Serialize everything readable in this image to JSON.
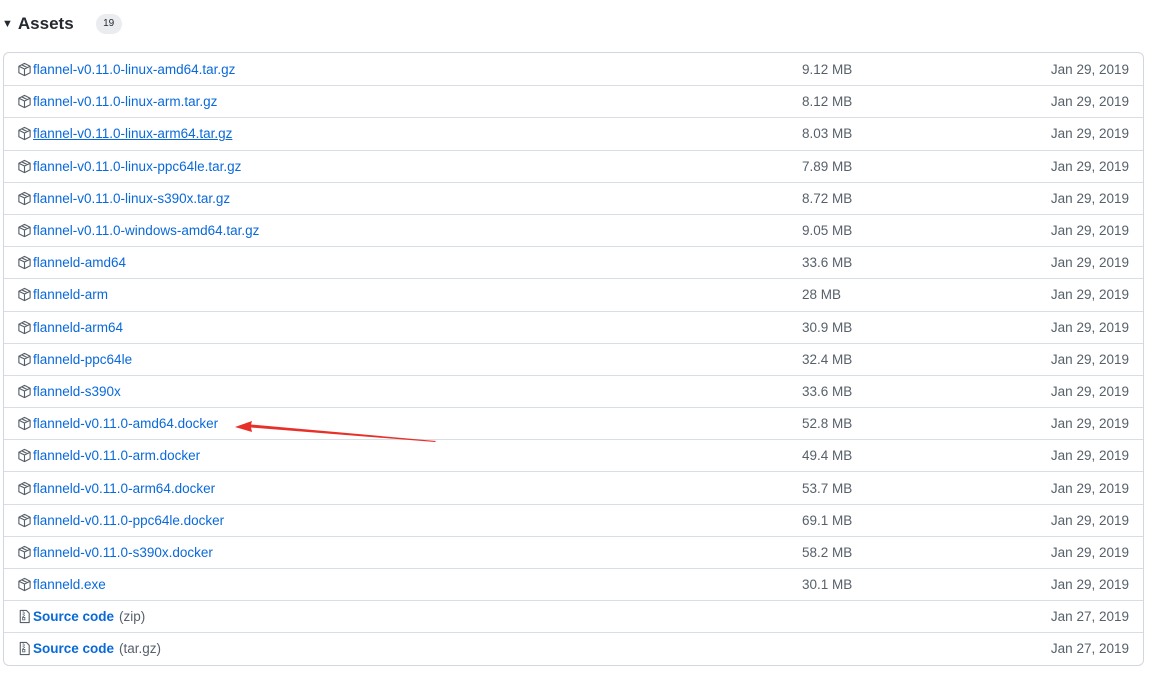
{
  "assets": {
    "title": "Assets",
    "count": "19",
    "caret_icon": "triangle-down-icon",
    "rows": [
      {
        "name": "flannel-v0.11.0-linux-amd64.tar.gz",
        "size": "9.12 MB",
        "date": "Jan 29, 2019",
        "icon": "package-icon"
      },
      {
        "name": "flannel-v0.11.0-linux-arm.tar.gz",
        "size": "8.12 MB",
        "date": "Jan 29, 2019",
        "icon": "package-icon"
      },
      {
        "name": "flannel-v0.11.0-linux-arm64.tar.gz",
        "size": "8.03 MB",
        "date": "Jan 29, 2019",
        "icon": "package-icon",
        "hovered": true
      },
      {
        "name": "flannel-v0.11.0-linux-ppc64le.tar.gz",
        "size": "7.89 MB",
        "date": "Jan 29, 2019",
        "icon": "package-icon"
      },
      {
        "name": "flannel-v0.11.0-linux-s390x.tar.gz",
        "size": "8.72 MB",
        "date": "Jan 29, 2019",
        "icon": "package-icon"
      },
      {
        "name": "flannel-v0.11.0-windows-amd64.tar.gz",
        "size": "9.05 MB",
        "date": "Jan 29, 2019",
        "icon": "package-icon"
      },
      {
        "name": "flanneld-amd64",
        "size": "33.6 MB",
        "date": "Jan 29, 2019",
        "icon": "package-icon"
      },
      {
        "name": "flanneld-arm",
        "size": "28 MB",
        "date": "Jan 29, 2019",
        "icon": "package-icon"
      },
      {
        "name": "flanneld-arm64",
        "size": "30.9 MB",
        "date": "Jan 29, 2019",
        "icon": "package-icon"
      },
      {
        "name": "flanneld-ppc64le",
        "size": "32.4 MB",
        "date": "Jan 29, 2019",
        "icon": "package-icon"
      },
      {
        "name": "flanneld-s390x",
        "size": "33.6 MB",
        "date": "Jan 29, 2019",
        "icon": "package-icon"
      },
      {
        "name": "flanneld-v0.11.0-amd64.docker",
        "size": "52.8 MB",
        "date": "Jan 29, 2019",
        "icon": "package-icon"
      },
      {
        "name": "flanneld-v0.11.0-arm.docker",
        "size": "49.4 MB",
        "date": "Jan 29, 2019",
        "icon": "package-icon"
      },
      {
        "name": "flanneld-v0.11.0-arm64.docker",
        "size": "53.7 MB",
        "date": "Jan 29, 2019",
        "icon": "package-icon"
      },
      {
        "name": "flanneld-v0.11.0-ppc64le.docker",
        "size": "69.1 MB",
        "date": "Jan 29, 2019",
        "icon": "package-icon"
      },
      {
        "name": "flanneld-v0.11.0-s390x.docker",
        "size": "58.2 MB",
        "date": "Jan 29, 2019",
        "icon": "package-icon"
      },
      {
        "name": "flanneld.exe",
        "size": "30.1 MB",
        "date": "Jan 29, 2019",
        "icon": "package-icon"
      },
      {
        "name": "Source code",
        "ext": "(zip)",
        "size": "",
        "date": "Jan 27, 2019",
        "icon": "file-zip-icon",
        "source": true
      },
      {
        "name": "Source code",
        "ext": "(tar.gz)",
        "size": "",
        "date": "Jan 27, 2019",
        "icon": "file-zip-icon",
        "source": true
      }
    ]
  },
  "annotation": {
    "type": "red-arrow-icon",
    "points_to": "flanneld-v0.11.0-amd64.docker",
    "color": "#e8302a"
  },
  "colors": {
    "link": "#0969da",
    "muted": "#57606a",
    "border": "#d0d7de"
  }
}
